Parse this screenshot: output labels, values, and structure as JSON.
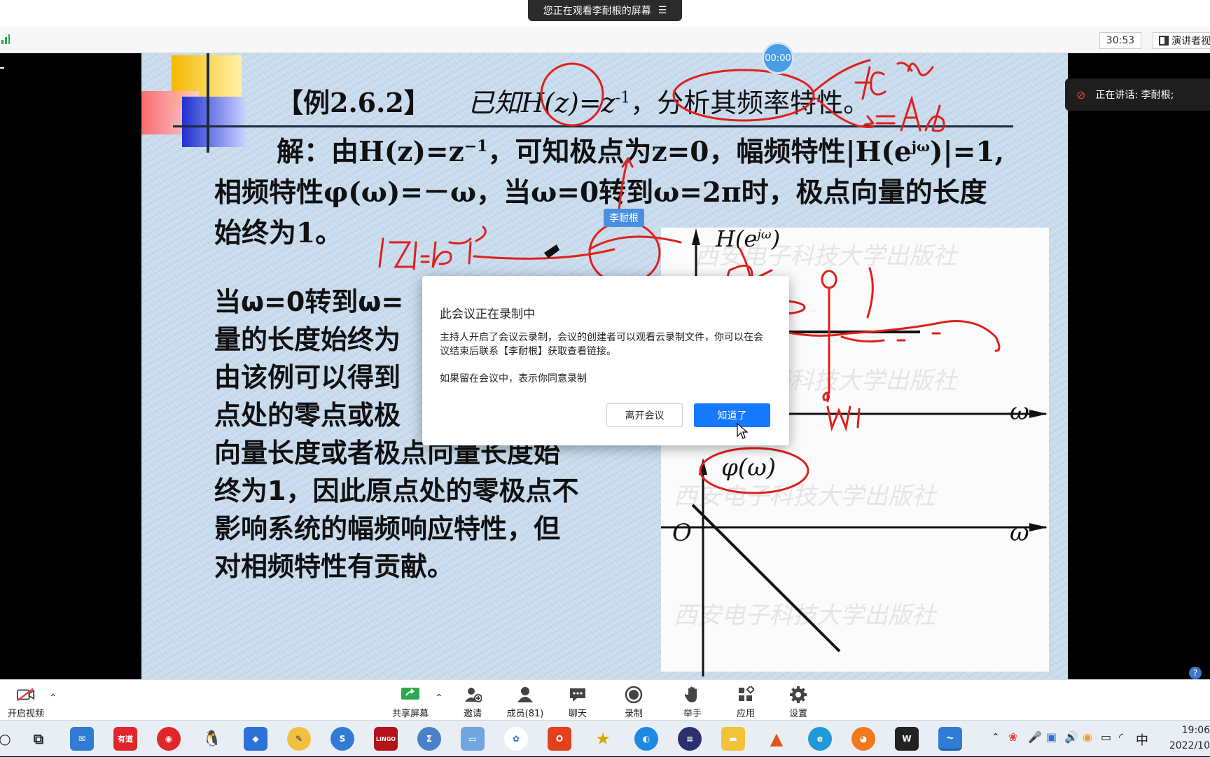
{
  "share_banner": {
    "text": "您正在观看李耐根的屏幕"
  },
  "toolbar": {
    "timer": "30:53",
    "presenter_view": "演讲者视"
  },
  "recording_badge": {
    "time": "00:00"
  },
  "speaker": {
    "text": "正在讲话: 李耐根;"
  },
  "slide": {
    "title_prefix": "【例2.6.2】",
    "title_main": "已知H(z)=z",
    "title_sup": "-1",
    "title_suffix": "，分析其频率特性。",
    "line1_prefix": "解：由H(z)=z",
    "line1_sup": "−1",
    "line1_suffix": "，可知极点为z=0，幅频特性|H(e",
    "line1_sup2": "jω",
    "line1_end": ")|=1,",
    "line2": "相频特性φ(ω)=－ω，当ω=0转到ω=2π时，极点向量的长度",
    "line3": "始终为1。",
    "para": [
      "当ω=0转到ω=",
      "量的长度始终为",
      "由该例可以得到",
      "点处的零点或极",
      "向量长度或者极点向量长度始",
      "终为1，因此原点处的零极点不",
      "影响系统的幅频响应特性，但",
      "对相频特性有贡献。"
    ],
    "annotator_label": "李耐根",
    "graph1_label": "H(e",
    "graph1_sup": "jω",
    "graph1_close": ")",
    "graph2_label": "φ(ω)",
    "axis_omega": "ω",
    "origin": "O",
    "watermark": "西安电子科技大学出版社",
    "handwriting_w1": "W1"
  },
  "dialog": {
    "title": "此会议正在录制中",
    "body": "主持人开启了会议云录制，会议的创建者可以观看云录制文件，你可以在会议结束后联系【李耐根】获取查看链接。",
    "note": "如果留在会议中，表示你同意录制",
    "leave_label": "离开会议",
    "ok_label": "知道了"
  },
  "meeting_bar": {
    "video_label": "开启视频",
    "share_label": "共享屏幕",
    "invite_label": "邀请",
    "members_label": "成员(81)",
    "chat_label": "聊天",
    "record_label": "录制",
    "raise_label": "举手",
    "apps_label": "应用",
    "settings_label": "设置"
  },
  "taskbar": {
    "youdao": "有道",
    "lingo": "LINGO",
    "ime": "中",
    "time": "19:06",
    "date": "2022/10"
  },
  "colors": {
    "accent": "#1677ff",
    "ink": "#e0201b",
    "slide_bg": "#c9dced"
  }
}
